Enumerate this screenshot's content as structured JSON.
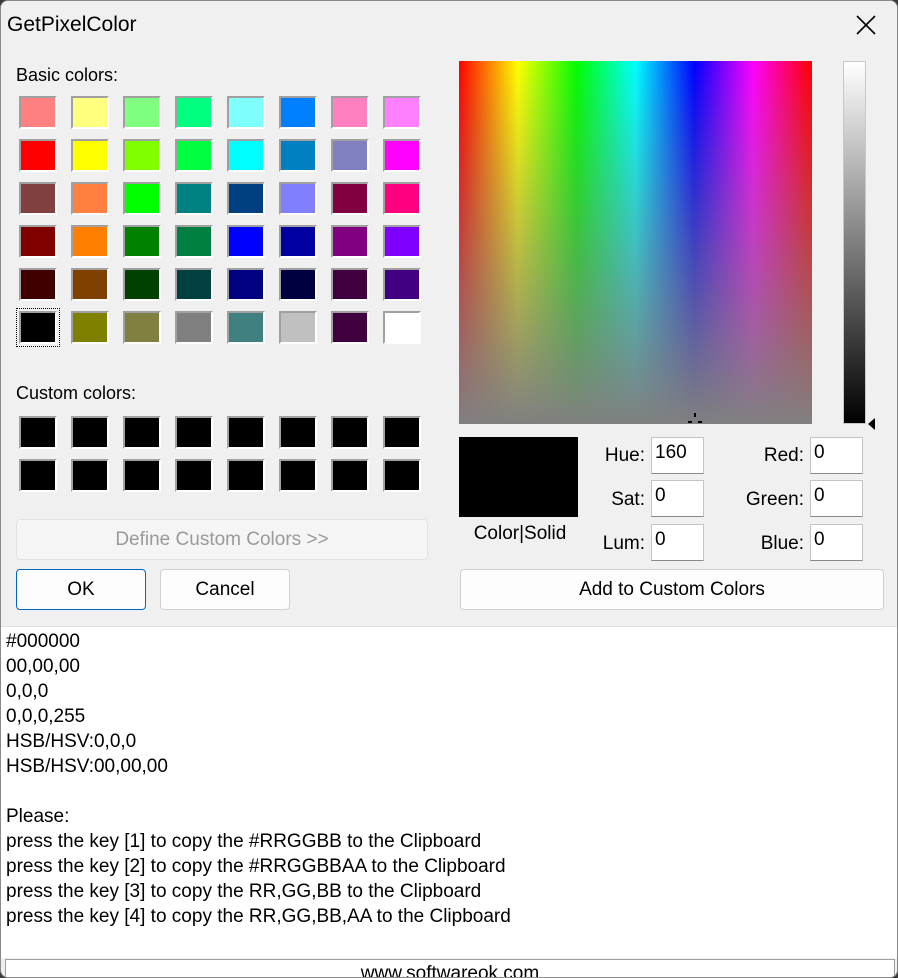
{
  "window": {
    "title": "GetPixelColor",
    "close_icon": "close-icon"
  },
  "basic_colors": {
    "label": "Basic colors:",
    "swatches": [
      "#ff8080",
      "#ffff80",
      "#80ff80",
      "#00ff80",
      "#80ffff",
      "#0080ff",
      "#ff80c0",
      "#ff80ff",
      "#ff0000",
      "#ffff00",
      "#80ff00",
      "#00ff40",
      "#00ffff",
      "#0080c0",
      "#8080c0",
      "#ff00ff",
      "#804040",
      "#ff8040",
      "#00ff00",
      "#008080",
      "#004080",
      "#8080ff",
      "#800040",
      "#ff0080",
      "#800000",
      "#ff8000",
      "#008000",
      "#008040",
      "#0000ff",
      "#0000a0",
      "#800080",
      "#8000ff",
      "#400000",
      "#804000",
      "#004000",
      "#004040",
      "#000080",
      "#000040",
      "#400040",
      "#400080",
      "#000000",
      "#808000",
      "#808040",
      "#808080",
      "#408080",
      "#c0c0c0",
      "#400040",
      "#ffffff"
    ],
    "selected_index": 40
  },
  "custom_colors": {
    "label": "Custom colors:",
    "swatches": [
      "#000000",
      "#000000",
      "#000000",
      "#000000",
      "#000000",
      "#000000",
      "#000000",
      "#000000",
      "#000000",
      "#000000",
      "#000000",
      "#000000",
      "#000000",
      "#000000",
      "#000000",
      "#000000"
    ]
  },
  "buttons": {
    "define_custom": "Define Custom Colors >>",
    "ok": "OK",
    "cancel": "Cancel",
    "add_custom": "Add to Custom Colors"
  },
  "preview": {
    "label": "Color|Solid",
    "color": "#000000"
  },
  "fields": {
    "hue": {
      "label": "Hue:",
      "value": "160"
    },
    "sat": {
      "label": "Sat:",
      "value": "0"
    },
    "lum": {
      "label": "Lum:",
      "value": "0"
    },
    "red": {
      "label": "Red:",
      "value": "0"
    },
    "green": {
      "label": "Green:",
      "value": "0"
    },
    "blue": {
      "label": "Blue:",
      "value": "0"
    }
  },
  "info_lines": [
    "#000000",
    "00,00,00",
    "0,0,0",
    "0,0,0,255",
    "HSB/HSV:0,0,0",
    "HSB/HSV:00,00,00",
    "",
    "Please:",
    "press the key [1] to copy the #RRGGBB to the Clipboard",
    "press the key [2] to copy the #RRGGBBAA to the Clipboard",
    "press the key [3] to copy the RR,GG,BB to the Clipboard",
    "press the key [4] to copy the RR,GG,BB,AA to the Clipboard"
  ],
  "status": {
    "text": "www.softwareok.com"
  }
}
